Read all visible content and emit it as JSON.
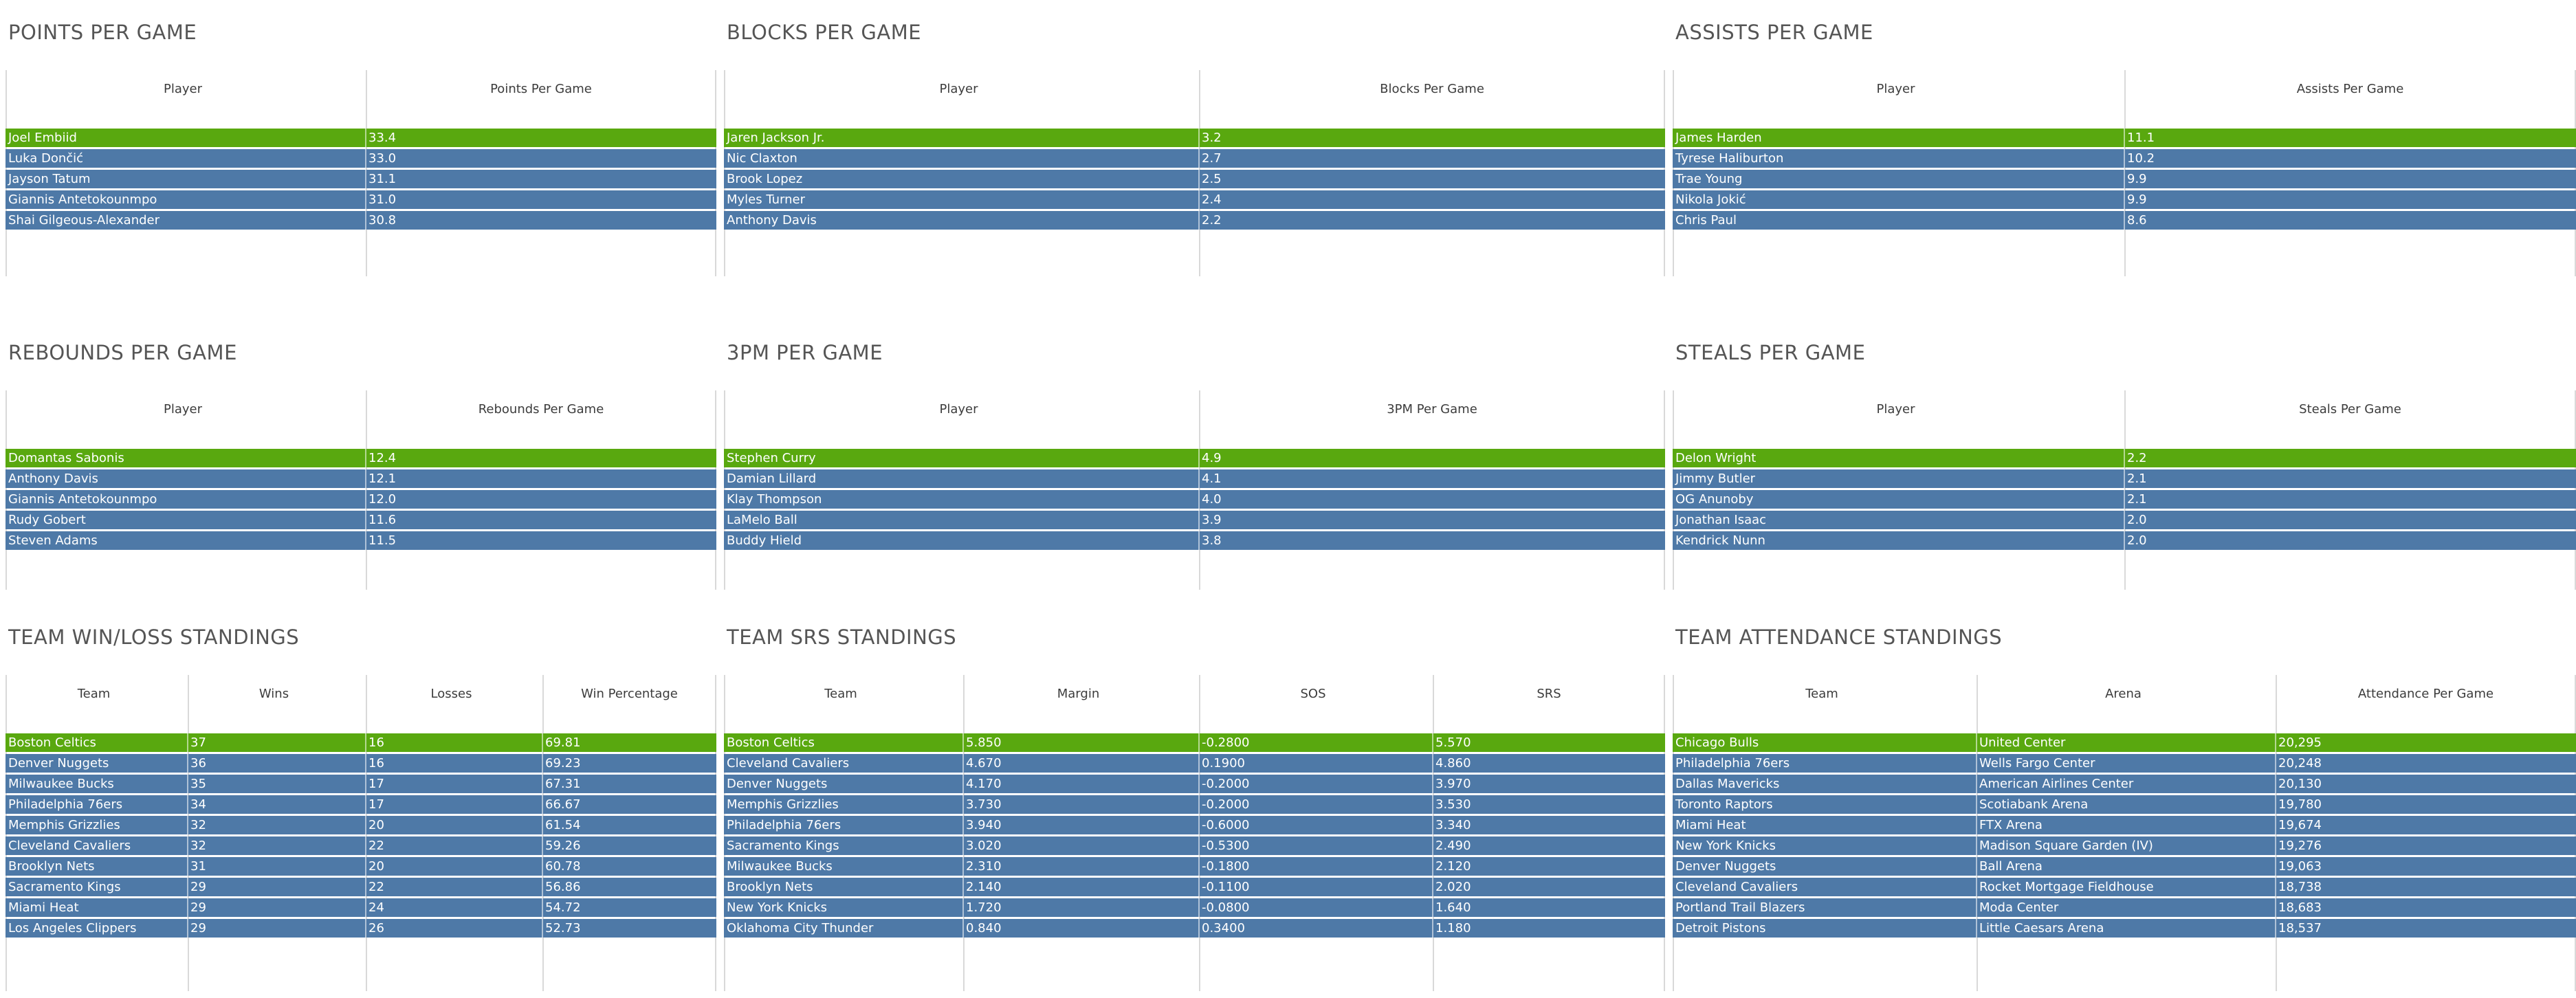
{
  "colors": {
    "highlight_row": "#59a80f",
    "row": "#4e79a7",
    "title": "#555555",
    "gridline": "#d9d9d9"
  },
  "panels": [
    {
      "title": "POINTS PER GAME",
      "columns": [
        "Player",
        "Points Per Game"
      ],
      "rows": [
        [
          "Joel Embiid",
          "33.4"
        ],
        [
          "Luka Dončić",
          "33.0"
        ],
        [
          "Jayson Tatum",
          "31.1"
        ],
        [
          "Giannis Antetokounmpo",
          "31.0"
        ],
        [
          "Shai Gilgeous-Alexander",
          "30.8"
        ]
      ]
    },
    {
      "title": "BLOCKS PER GAME",
      "columns": [
        "Player",
        "Blocks Per Game"
      ],
      "rows": [
        [
          "Jaren Jackson Jr.",
          "3.2"
        ],
        [
          "Nic Claxton",
          "2.7"
        ],
        [
          "Brook Lopez",
          "2.5"
        ],
        [
          "Myles Turner",
          "2.4"
        ],
        [
          "Anthony Davis",
          "2.2"
        ]
      ]
    },
    {
      "title": "ASSISTS PER GAME",
      "columns": [
        "Player",
        "Assists Per Game"
      ],
      "rows": [
        [
          "James Harden",
          "11.1"
        ],
        [
          "Tyrese Haliburton",
          "10.2"
        ],
        [
          "Trae Young",
          "9.9"
        ],
        [
          "Nikola Jokić",
          "9.9"
        ],
        [
          "Chris Paul",
          "8.6"
        ]
      ]
    },
    {
      "title": "REBOUNDS PER GAME",
      "columns": [
        "Player",
        "Rebounds Per Game"
      ],
      "rows": [
        [
          "Domantas Sabonis",
          "12.4"
        ],
        [
          "Anthony Davis",
          "12.1"
        ],
        [
          "Giannis Antetokounmpo",
          "12.0"
        ],
        [
          "Rudy Gobert",
          "11.6"
        ],
        [
          "Steven Adams",
          "11.5"
        ]
      ]
    },
    {
      "title": "3PM PER GAME",
      "columns": [
        "Player",
        "3PM Per Game"
      ],
      "rows": [
        [
          "Stephen Curry",
          "4.9"
        ],
        [
          "Damian Lillard",
          "4.1"
        ],
        [
          "Klay Thompson",
          "4.0"
        ],
        [
          "LaMelo Ball",
          "3.9"
        ],
        [
          "Buddy Hield",
          "3.8"
        ]
      ]
    },
    {
      "title": "STEALS PER GAME",
      "columns": [
        "Player",
        "Steals Per Game"
      ],
      "rows": [
        [
          "Delon Wright",
          "2.2"
        ],
        [
          "Jimmy Butler",
          "2.1"
        ],
        [
          "OG Anunoby",
          "2.1"
        ],
        [
          "Jonathan Isaac",
          "2.0"
        ],
        [
          "Kendrick Nunn",
          "2.0"
        ]
      ]
    },
    {
      "title": "TEAM WIN/LOSS STANDINGS",
      "columns": [
        "Team",
        "Wins",
        "Losses",
        "Win Percentage"
      ],
      "rows": [
        [
          "Boston Celtics",
          "37",
          "16",
          "69.81"
        ],
        [
          "Denver Nuggets",
          "36",
          "16",
          "69.23"
        ],
        [
          "Milwaukee Bucks",
          "35",
          "17",
          "67.31"
        ],
        [
          "Philadelphia 76ers",
          "34",
          "17",
          "66.67"
        ],
        [
          "Memphis Grizzlies",
          "32",
          "20",
          "61.54"
        ],
        [
          "Cleveland Cavaliers",
          "32",
          "22",
          "59.26"
        ],
        [
          "Brooklyn Nets",
          "31",
          "20",
          "60.78"
        ],
        [
          "Sacramento Kings",
          "29",
          "22",
          "56.86"
        ],
        [
          "Miami Heat",
          "29",
          "24",
          "54.72"
        ],
        [
          "Los Angeles Clippers",
          "29",
          "26",
          "52.73"
        ]
      ]
    },
    {
      "title": "TEAM SRS STANDINGS",
      "columns": [
        "Team",
        "Margin",
        "SOS",
        "SRS"
      ],
      "rows": [
        [
          "Boston Celtics",
          "5.850",
          "-0.2800",
          "5.570"
        ],
        [
          "Cleveland Cavaliers",
          "4.670",
          "0.1900",
          "4.860"
        ],
        [
          "Denver Nuggets",
          "4.170",
          "-0.2000",
          "3.970"
        ],
        [
          "Memphis Grizzlies",
          "3.730",
          "-0.2000",
          "3.530"
        ],
        [
          "Philadelphia 76ers",
          "3.940",
          "-0.6000",
          "3.340"
        ],
        [
          "Sacramento Kings",
          "3.020",
          "-0.5300",
          "2.490"
        ],
        [
          "Milwaukee Bucks",
          "2.310",
          "-0.1800",
          "2.120"
        ],
        [
          "Brooklyn Nets",
          "2.140",
          "-0.1100",
          "2.020"
        ],
        [
          "New York Knicks",
          "1.720",
          "-0.0800",
          "1.640"
        ],
        [
          "Oklahoma City Thunder",
          "0.840",
          "0.3400",
          "1.180"
        ]
      ]
    },
    {
      "title": "TEAM ATTENDANCE STANDINGS",
      "columns": [
        "Team",
        "Arena",
        "Attendance Per Game"
      ],
      "rows": [
        [
          "Chicago Bulls",
          "United Center",
          "20,295"
        ],
        [
          "Philadelphia 76ers",
          "Wells Fargo Center",
          "20,248"
        ],
        [
          "Dallas Mavericks",
          "American Airlines Center",
          "20,130"
        ],
        [
          "Toronto Raptors",
          "Scotiabank Arena",
          "19,780"
        ],
        [
          "Miami Heat",
          "FTX Arena",
          "19,674"
        ],
        [
          "New York Knicks",
          "Madison Square Garden (IV)",
          "19,276"
        ],
        [
          "Denver Nuggets",
          "Ball Arena",
          "19,063"
        ],
        [
          "Cleveland Cavaliers",
          "Rocket Mortgage Fieldhouse",
          "18,738"
        ],
        [
          "Portland Trail Blazers",
          "Moda Center",
          "18,683"
        ],
        [
          "Detroit Pistons",
          "Little Caesars Arena",
          "18,537"
        ]
      ]
    }
  ]
}
